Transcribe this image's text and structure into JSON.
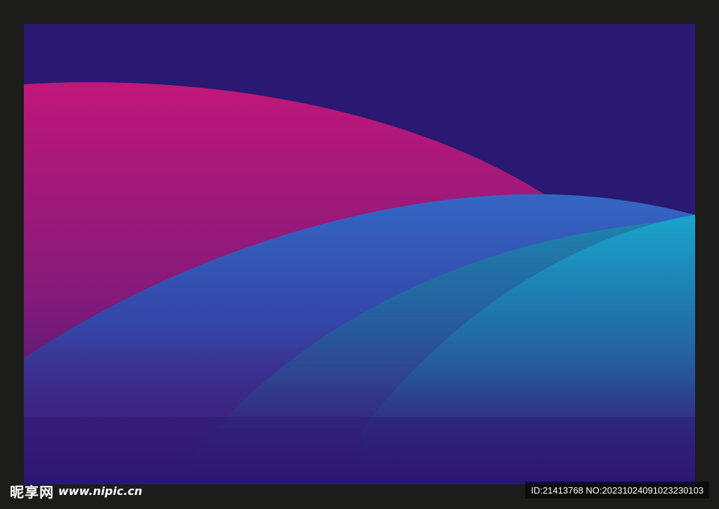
{
  "image": {
    "colors": {
      "frame": "#1c1c1a",
      "background": "#2a1872",
      "magenta": "#c0187a",
      "blue": "#3466c4",
      "teal": "#1aa0c8"
    }
  },
  "watermark": {
    "brand": "昵享网",
    "site": "www.nipic.cn",
    "id_text": "ID:21413768 NO:20231024091023230103"
  }
}
